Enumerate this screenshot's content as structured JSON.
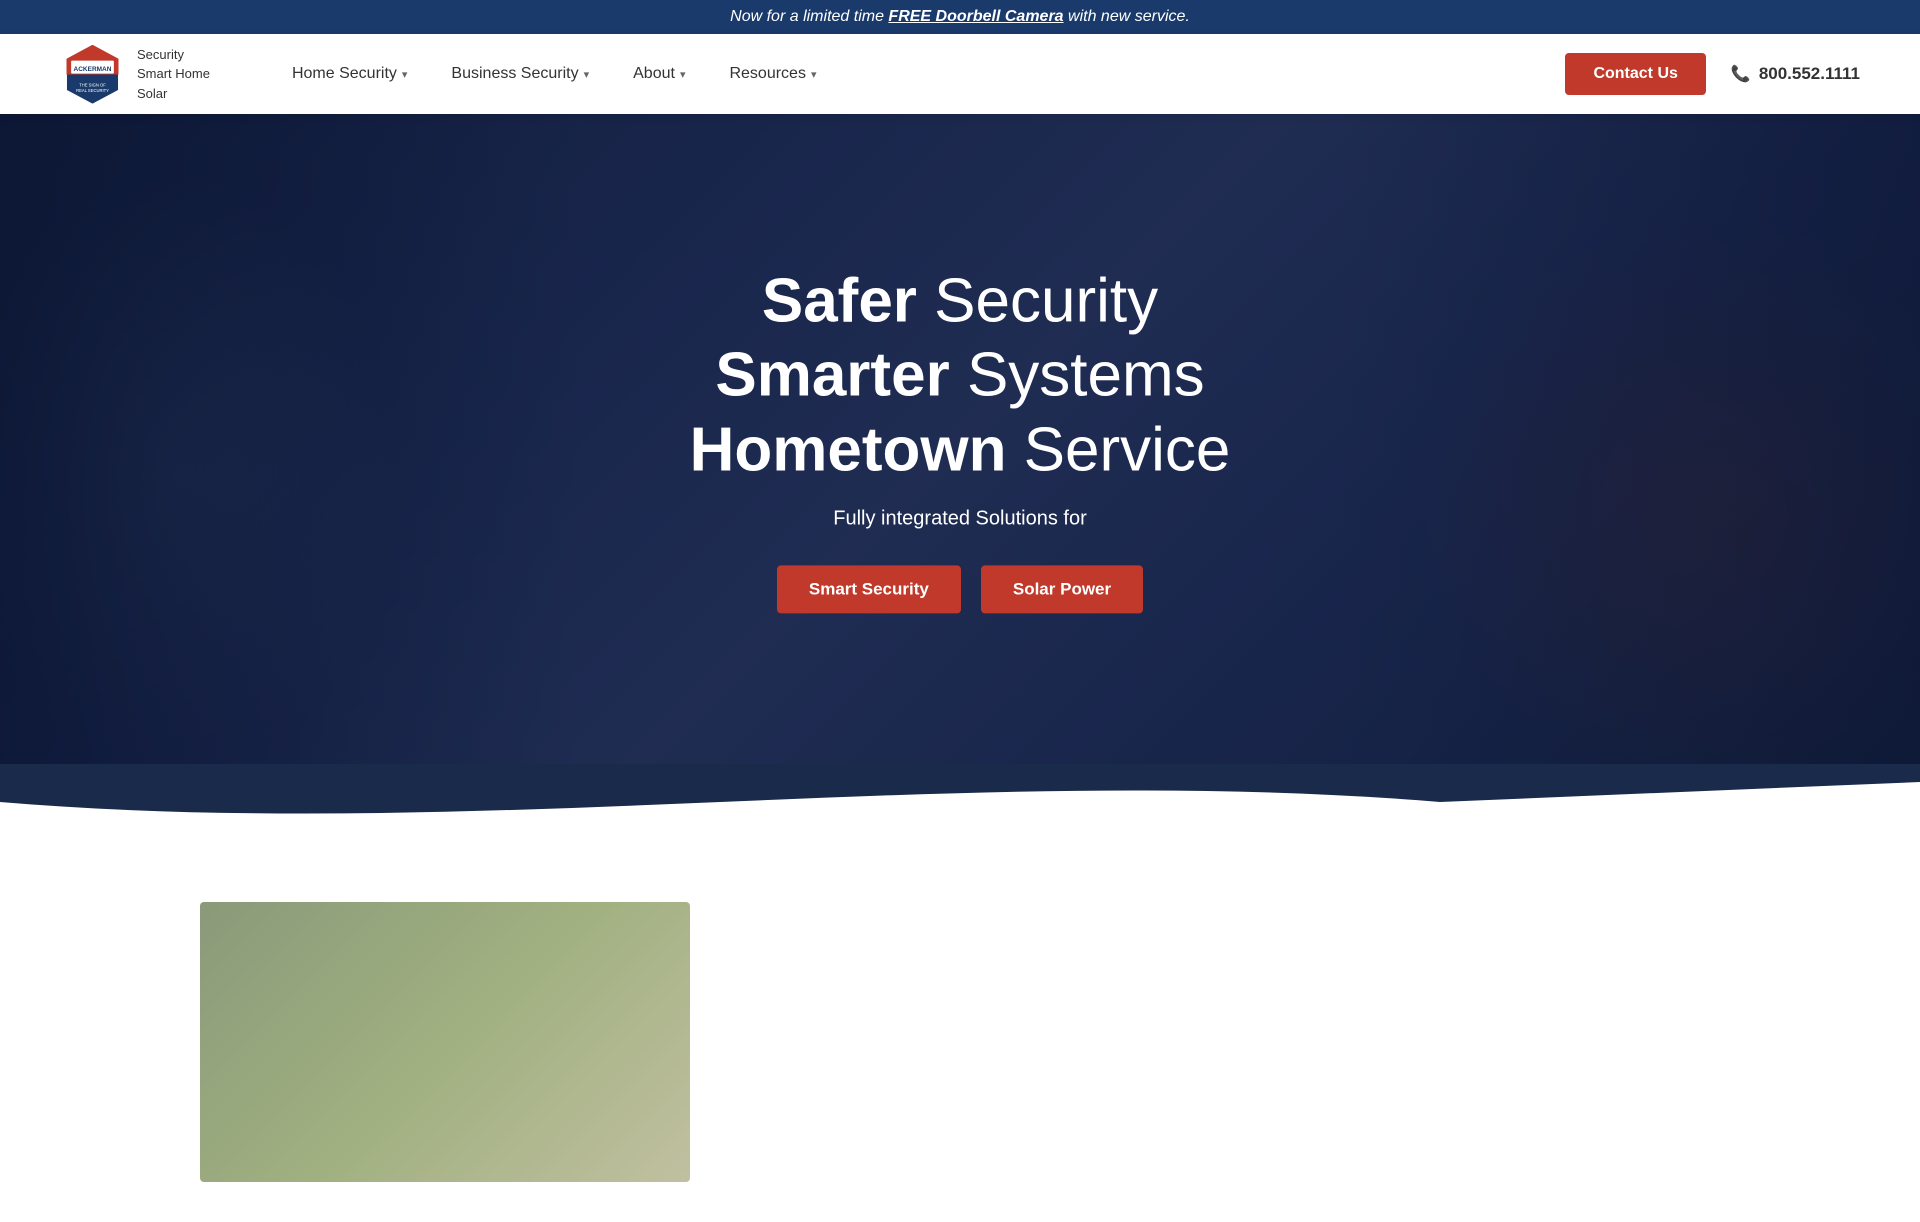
{
  "banner": {
    "text_before": "Now for a limited time ",
    "text_bold": "FREE Doorbell Camera",
    "text_after": " with new service."
  },
  "logo": {
    "company": "ACKERMAN",
    "tagline": "THE SIGN OF REAL SECURITY",
    "lines": [
      "Security",
      "Smart Home",
      "Solar"
    ]
  },
  "nav": {
    "items": [
      {
        "label": "Home Security",
        "has_dropdown": true
      },
      {
        "label": "Business Security",
        "has_dropdown": true
      },
      {
        "label": "About",
        "has_dropdown": true
      },
      {
        "label": "Resources",
        "has_dropdown": true
      }
    ],
    "contact_label": "Contact Us",
    "phone": "800.552.1111"
  },
  "hero": {
    "line1_bold": "Safer",
    "line1_light": "Security",
    "line2_bold": "Smarter",
    "line2_light": "Systems",
    "line3_bold": "Hometown",
    "line3_light": "Service",
    "subtitle": "Fully integrated Solutions for",
    "btn1": "Smart Security",
    "btn2": "Solar Power"
  }
}
